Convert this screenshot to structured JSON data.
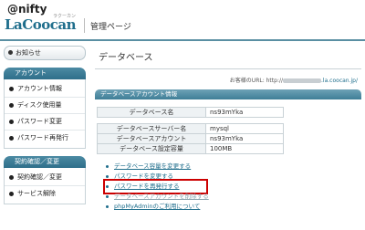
{
  "header": {
    "brand_top": "@nifty",
    "brand_main": "LaCoocan",
    "brand_ruby": "ラクーカン",
    "title": "管理ページ"
  },
  "sidebar": {
    "notice": "お知らせ",
    "account_head": "アカウント",
    "account_items": [
      "アカウント情報",
      "ディスク使用量",
      "パスワード変更",
      "パスワード再発行"
    ],
    "contract_head": "契約確認／変更",
    "contract_items": [
      "契約確認／変更",
      "サービス解除"
    ]
  },
  "main": {
    "title": "データベース",
    "url_label": "お客様のURL: http://",
    "url_suffix": ".la.coocan.jp/",
    "section": "データベースアカウント情報",
    "rows1": [
      {
        "key": "データベース名",
        "value": "ns93mYka"
      }
    ],
    "rows2": [
      {
        "key": "データベースサーバー名",
        "value": "mysql"
      },
      {
        "key": "データベースアカウント",
        "value": "ns93mYka"
      },
      {
        "key": "データベース設定容量",
        "value": "100MB"
      }
    ],
    "links": [
      "データベース容量を変更する",
      "パスワードを変更する",
      "パスワードを再発行する",
      "データベースアカウントを削除する",
      "phpMyAdminのご利用について"
    ]
  }
}
